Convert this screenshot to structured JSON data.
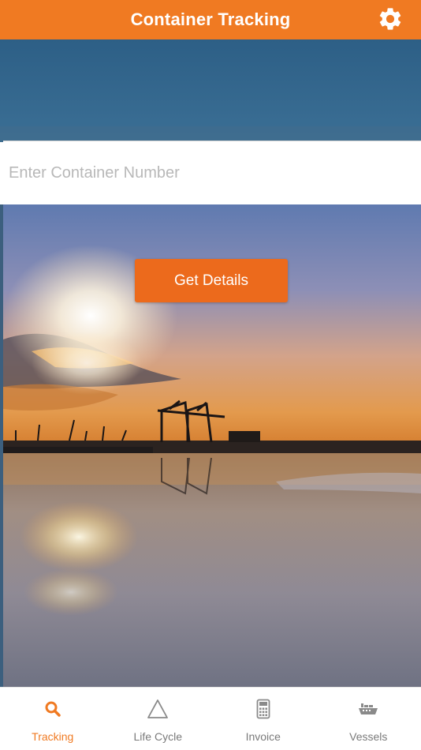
{
  "header": {
    "title": "Container Tracking",
    "settings_icon": "gear-icon"
  },
  "search": {
    "placeholder": "Enter Container Number",
    "value": ""
  },
  "actions": {
    "get_details_label": "Get Details"
  },
  "tabs": [
    {
      "label": "Tracking",
      "icon": "search-icon",
      "active": true
    },
    {
      "label": "Life Cycle",
      "icon": "triangle-icon",
      "active": false
    },
    {
      "label": "Invoice",
      "icon": "calculator-icon",
      "active": false
    },
    {
      "label": "Vessels",
      "icon": "ship-icon",
      "active": false
    }
  ],
  "colors": {
    "accent": "#f07a22",
    "button": "#ec6a1c",
    "inactive_tab": "#7a7a7a"
  }
}
